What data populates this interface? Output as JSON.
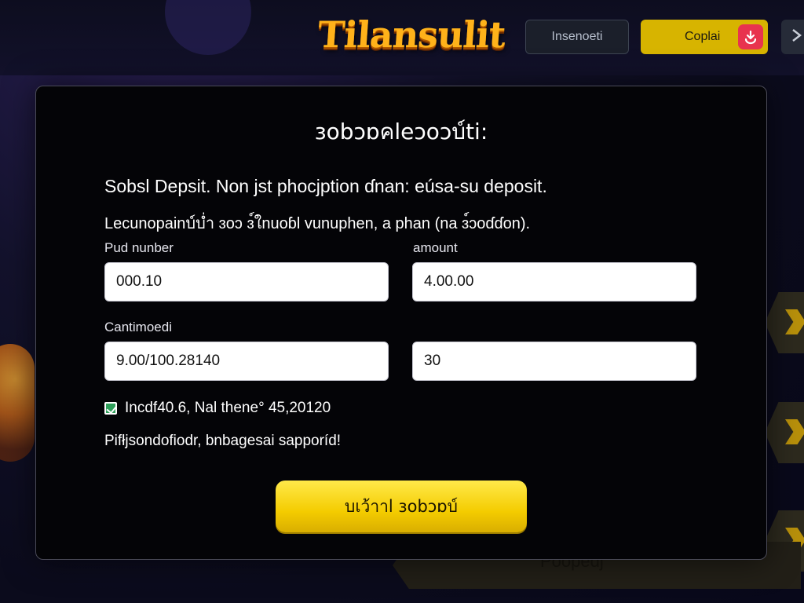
{
  "header": {
    "logo": "Tilansulit",
    "login_label": "Insenoeti",
    "signup_label": "Coplai",
    "signup_icon": "download-icon",
    "menu_icon": "chevron-right-icon"
  },
  "background": {
    "banner_text": "Poopedj"
  },
  "modal": {
    "title": "ɜobɔɒคleɔoɔบ์ti:",
    "intro": "Sobsl Depsit. Non jst phocjption ɗnan: eúsa-su deposit.",
    "subintro": "Lecunopainบ์บ่ำ ɜoɔ ɜ์ใnuoɓl vunuphen, a phan (na ɜ์ɔoɗɗon).",
    "fields": {
      "label_1": "Pud nunber",
      "value_1": "000.10",
      "label_2": "amount",
      "value_2": "4.00.00",
      "label_3": "Cantimoedi",
      "value_3": "9.00/100.28140",
      "value_4": "30"
    },
    "checkbox_label": "Incdf40.6, Nal thene° 45,20120",
    "note": "Pifłjsondofiodr, bnbagesai sapporíd!",
    "submit_label": "บเว้าาl ɜobɔɒบ์"
  },
  "colors": {
    "accent_yellow": "#f4cc00",
    "download_red": "#e8334e",
    "modal_bg": "#040407"
  }
}
